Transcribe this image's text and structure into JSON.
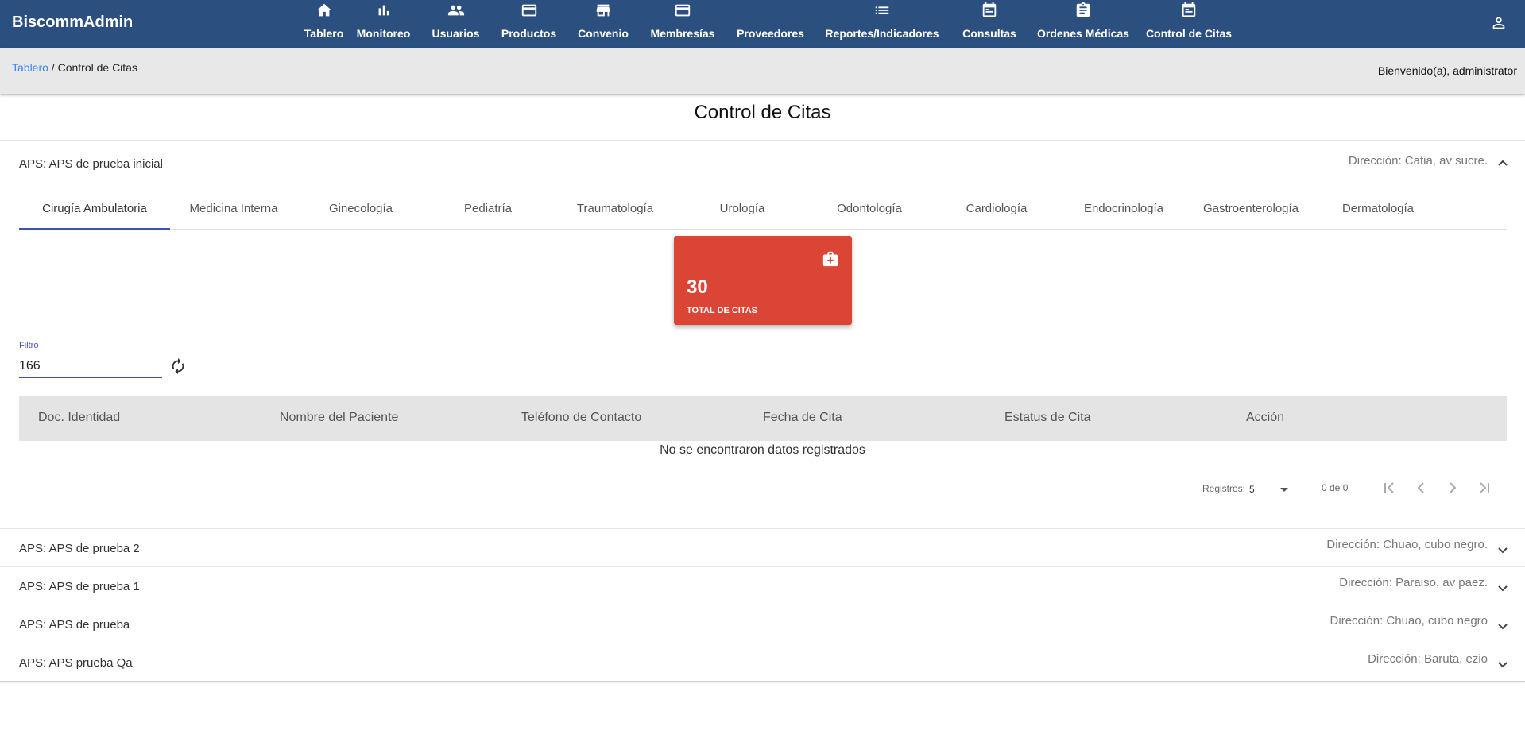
{
  "app": {
    "brand": "BiscommAdmin"
  },
  "nav": [
    {
      "label": "Tablero",
      "icon": "home-icon"
    },
    {
      "label": "Monitoreo",
      "icon": "bar-chart-icon"
    },
    {
      "label": "Usuarios",
      "icon": "people-icon"
    },
    {
      "label": "Productos",
      "icon": "credit-card-icon"
    },
    {
      "label": "Convenio",
      "icon": "store-icon"
    },
    {
      "label": "Membresías",
      "icon": "credit-card-icon"
    },
    {
      "label": "Proveedores",
      "icon": ""
    },
    {
      "label": "Reportes/Indicadores",
      "icon": "list-icon"
    },
    {
      "label": "Consultas",
      "icon": "calendar-icon"
    },
    {
      "label": "Ordenes Médicas",
      "icon": "clipboard-icon"
    },
    {
      "label": "Control de Citas",
      "icon": "calendar-icon"
    }
  ],
  "breadcrumb": {
    "home": "Tablero",
    "separator": " / ",
    "current": "Control de Citas"
  },
  "welcome": "Bienvenido(a), administrator",
  "page": {
    "title": "Control de Citas"
  },
  "panels": [
    {
      "title": "APS: APS de prueba inicial",
      "address": "Dirección: Catia, av sucre.",
      "expanded": true
    },
    {
      "title": "APS: APS de prueba 2",
      "address": "Dirección: Chuao, cubo negro.",
      "expanded": false
    },
    {
      "title": "APS: APS de prueba 1",
      "address": "Dirección: Paraiso, av paez.",
      "expanded": false
    },
    {
      "title": "APS: APS de prueba",
      "address": "Dirección: Chuao, cubo negro",
      "expanded": false
    },
    {
      "title": "APS: APS prueba Qa",
      "address": "Dirección: Baruta, ezio",
      "expanded": false
    }
  ],
  "tabs": [
    "Cirugía Ambulatoria",
    "Medicina Interna",
    "Ginecología",
    "Pediatría",
    "Traumatología",
    "Urología",
    "Odontología",
    "Cardiología",
    "Endocrinología",
    "Gastroenterología",
    "Dermatología"
  ],
  "active_tab": "Cirugía Ambulatoria",
  "stat": {
    "value": "30",
    "label": "TOTAL DE CITAS",
    "icon": "medical-bag-icon",
    "color": "#db4535"
  },
  "filter": {
    "label": "Filtro",
    "value": "166"
  },
  "table": {
    "headers": [
      "Doc. Identidad",
      "Nombre del Paciente",
      "Teléfono de Contacto",
      "Fecha de Cita",
      "Estatus de Cita",
      "Acción"
    ],
    "empty_message": "No se encontraron datos registrados"
  },
  "paginator": {
    "label": "Registros:",
    "page_size": "5",
    "range": "0 de 0"
  },
  "colors": {
    "topbar": "#2b4f7e",
    "accent": "#3f51b5",
    "link": "#3b82f6",
    "card": "#db4535"
  }
}
